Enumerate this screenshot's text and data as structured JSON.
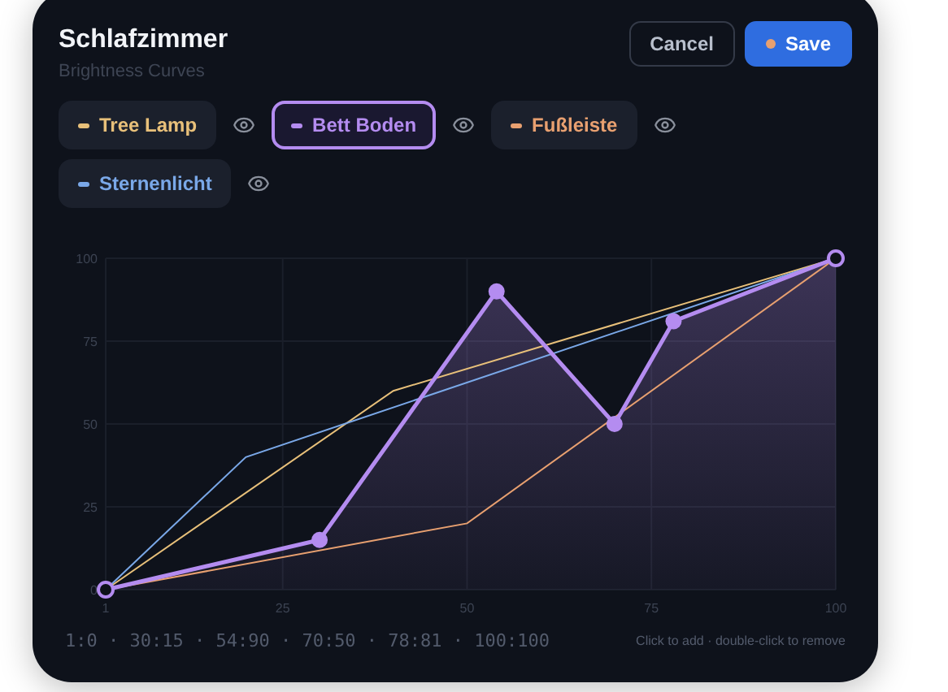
{
  "header": {
    "title": "Schlafzimmer",
    "subtitle": "Brightness Curves"
  },
  "buttons": [
    {
      "label": "Cancel",
      "kind": "secondary"
    },
    {
      "label": "Save",
      "kind": "primary",
      "dirty": true
    }
  ],
  "curves": [
    {
      "selected": false,
      "visible": true
    },
    {
      "selected": true,
      "visible": true
    },
    {
      "selected": false,
      "visible": true
    },
    {
      "selected": false,
      "visible": true
    }
  ],
  "chart_data": {
    "type": "line",
    "grid": true,
    "x": [
      1,
      20,
      25,
      30,
      40,
      50,
      54,
      70,
      75,
      78,
      100
    ],
    "xlim": [
      1,
      100
    ],
    "ylim": [
      0,
      100
    ],
    "xticks": [
      1,
      25,
      50,
      75,
      100
    ],
    "yticks": [
      0,
      25,
      50,
      75,
      100
    ],
    "series": [
      {
        "name": "Tree Lamp",
        "color": "#e8c07a",
        "values": [
          0,
          null,
          null,
          null,
          60,
          null,
          null,
          null,
          null,
          null,
          100
        ]
      },
      {
        "name": "Bett Boden",
        "color": "#b48cf0",
        "marker": "circle",
        "values": [
          0,
          null,
          null,
          15,
          null,
          null,
          90,
          50,
          null,
          81,
          100
        ]
      },
      {
        "name": "Fußleiste",
        "color": "#e8a070",
        "values": [
          0,
          null,
          null,
          null,
          null,
          20,
          null,
          null,
          null,
          null,
          100
        ]
      },
      {
        "name": "Sternenlicht",
        "color": "#7aa8e8",
        "values": [
          0,
          40,
          null,
          null,
          null,
          null,
          null,
          null,
          null,
          null,
          100
        ]
      }
    ]
  },
  "footer": {
    "points": "1:0 · 30:15 · 54:90 · 70:50 · 78:81 · 100:100",
    "hint": "Click to add · double-click to remove"
  }
}
